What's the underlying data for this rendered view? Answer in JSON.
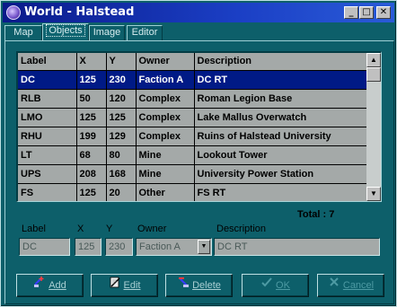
{
  "window": {
    "title": "World - Halstead"
  },
  "title_buttons": {
    "minimize": "_",
    "maximize": "□",
    "close": "✕"
  },
  "tabs": [
    {
      "label": "Map",
      "active": false
    },
    {
      "label": "Objects",
      "active": true
    },
    {
      "label": "Image",
      "active": false
    },
    {
      "label": "Editor",
      "active": false
    }
  ],
  "grid": {
    "columns": [
      "Label",
      "X",
      "Y",
      "Owner",
      "Description"
    ],
    "rows": [
      {
        "label": "DC",
        "x": "125",
        "y": "230",
        "owner": "Faction A",
        "description": "DC RT",
        "selected": true
      },
      {
        "label": "RLB",
        "x": "50",
        "y": "120",
        "owner": "Complex",
        "description": "Roman Legion Base"
      },
      {
        "label": "LMO",
        "x": "125",
        "y": "125",
        "owner": "Complex",
        "description": "Lake Mallus Overwatch"
      },
      {
        "label": "RHU",
        "x": "199",
        "y": "129",
        "owner": "Complex",
        "description": "Ruins of Halstead University"
      },
      {
        "label": "LT",
        "x": "68",
        "y": "80",
        "owner": "Mine",
        "description": "Lookout Tower"
      },
      {
        "label": "UPS",
        "x": "208",
        "y": "168",
        "owner": "Mine",
        "description": "University Power Station"
      },
      {
        "label": "FS",
        "x": "125",
        "y": "20",
        "owner": "Other",
        "description": "FS RT"
      }
    ],
    "total_text": "Total : 7"
  },
  "editor": {
    "label_caption": "Label",
    "x_caption": "X",
    "y_caption": "Y",
    "owner_caption": "Owner",
    "description_caption": "Description",
    "label_value": "DC",
    "x_value": "125",
    "y_value": "230",
    "owner_value": "Faction A",
    "description_value": "DC RT"
  },
  "buttons": {
    "add": "Add",
    "edit": "Edit",
    "delete": "Delete",
    "ok": "OK",
    "cancel": "Cancel"
  },
  "colors": {
    "window_bg": "#0d5f6a",
    "selection": "#001a86",
    "grid_cell": "#a4a9a8",
    "title_bar": "#0a1a8a"
  }
}
